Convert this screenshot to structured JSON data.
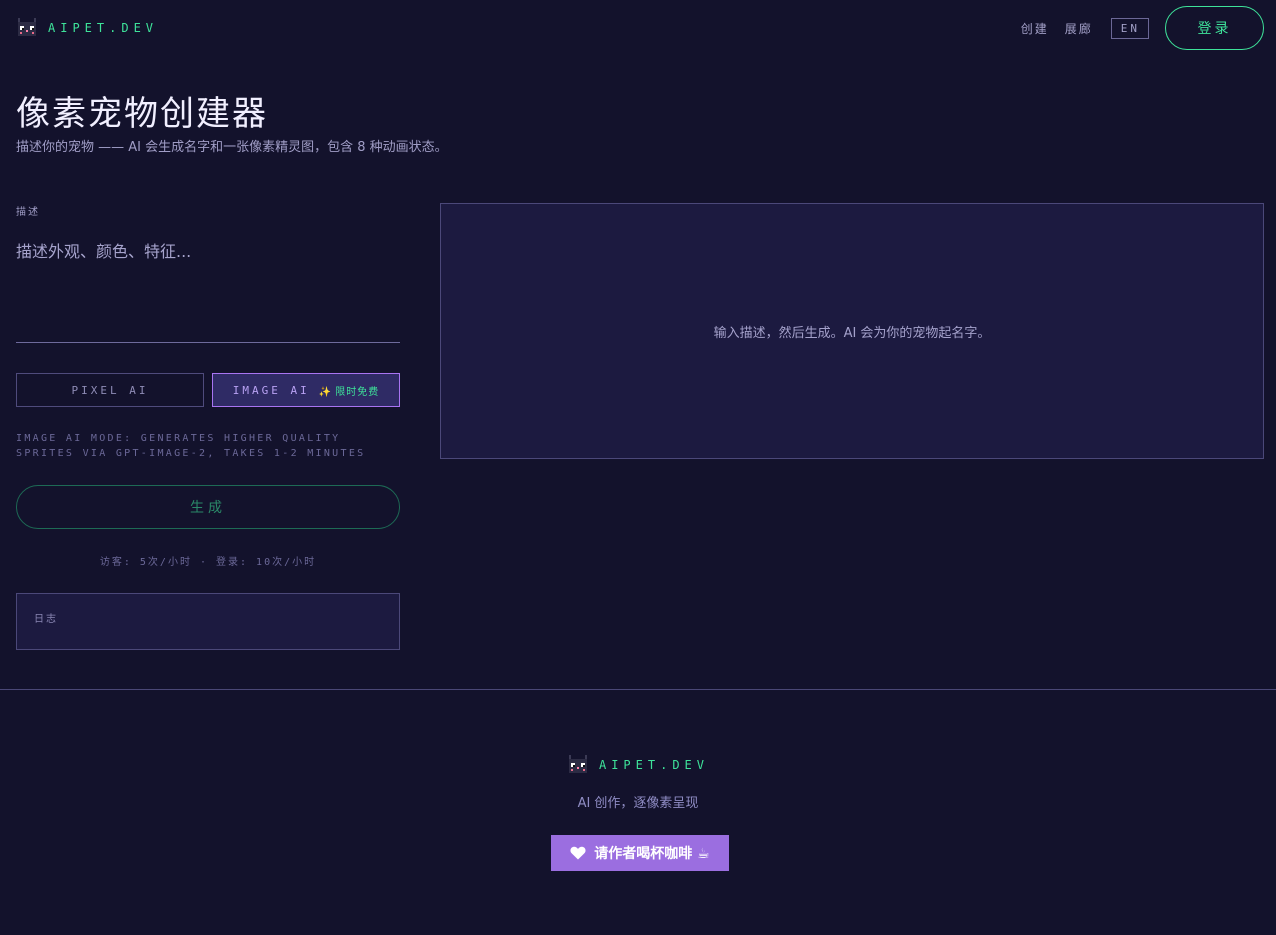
{
  "header": {
    "logo_text": "AIPET.DEV",
    "nav": [
      {
        "label": "创建"
      },
      {
        "label": "展廊"
      }
    ],
    "lang_label": "EN",
    "login_label": "登录"
  },
  "main": {
    "title": "像素宠物创建器",
    "subtitle": "描述你的宠物 —— AI 会生成名字和一张像素精灵图，包含 8 种动画状态。",
    "description_label": "描述",
    "description_placeholder": "描述外观、颜色、特征...",
    "description_value": "",
    "modes": {
      "pixel_label": "PIXEL AI",
      "image_label": "IMAGE AI",
      "image_badge": "限时免费",
      "selected": "IMAGE AI"
    },
    "mode_note": "IMAGE AI MODE: GENERATES HIGHER QUALITY SPRITES VIA GPT-IMAGE-2, TAKES 1-2 MINUTES",
    "generate_label": "生成",
    "quota_text": "访客: 5次/小时 · 登录: 10次/小时",
    "log_label": "日志",
    "preview_text": "输入描述，然后生成。AI 会为你的宠物起名字。"
  },
  "footer": {
    "logo_text": "AIPET.DEV",
    "tagline": "AI 创作，逐像素呈现",
    "coffee_label": "请作者喝杯咖啡 ☕"
  },
  "colors": {
    "background": "#13122c",
    "accent_green": "#3ee39a",
    "accent_purple": "#a874f2",
    "panel": "#1c1a40",
    "coffee_button": "#9b6ee0"
  }
}
